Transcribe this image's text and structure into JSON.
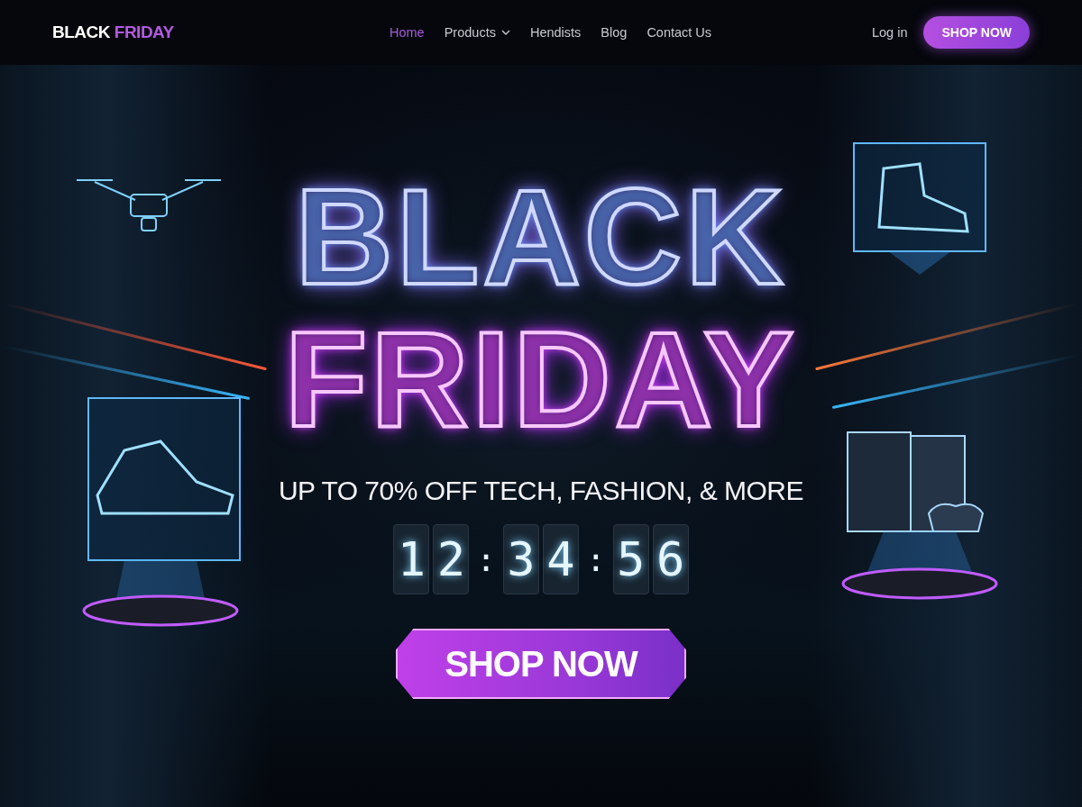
{
  "nav": {
    "brand": {
      "text": "BLACK",
      "accent": "FRIDAY"
    },
    "links": [
      {
        "label": "Home",
        "selected": true,
        "kind": "link"
      },
      {
        "label": "Products",
        "selected": false,
        "kind": "dropdown"
      },
      {
        "label": "Hendists",
        "selected": false,
        "kind": "link"
      },
      {
        "label": "Blog",
        "selected": false,
        "kind": "link"
      },
      {
        "label": "Contact Us",
        "selected": false,
        "kind": "link"
      }
    ],
    "login": "Log in",
    "cta": "SHOP NOW"
  },
  "hero": {
    "title_lines": [
      "BLACK",
      "FRIDAY"
    ],
    "subtitle": "UP TO 70% OFF TECH, FASHION, & MORE",
    "countdown": [
      {
        "kind": "digit",
        "text": "1"
      },
      {
        "kind": "digit",
        "text": "2"
      },
      {
        "kind": "separator",
        "text": ":"
      },
      {
        "kind": "digit",
        "text": "3"
      },
      {
        "kind": "digit",
        "text": "4"
      },
      {
        "kind": "separator",
        "text": ":"
      },
      {
        "kind": "digit",
        "text": "5"
      },
      {
        "kind": "digit",
        "text": "6"
      }
    ],
    "cta": "SHOP NOW"
  }
}
